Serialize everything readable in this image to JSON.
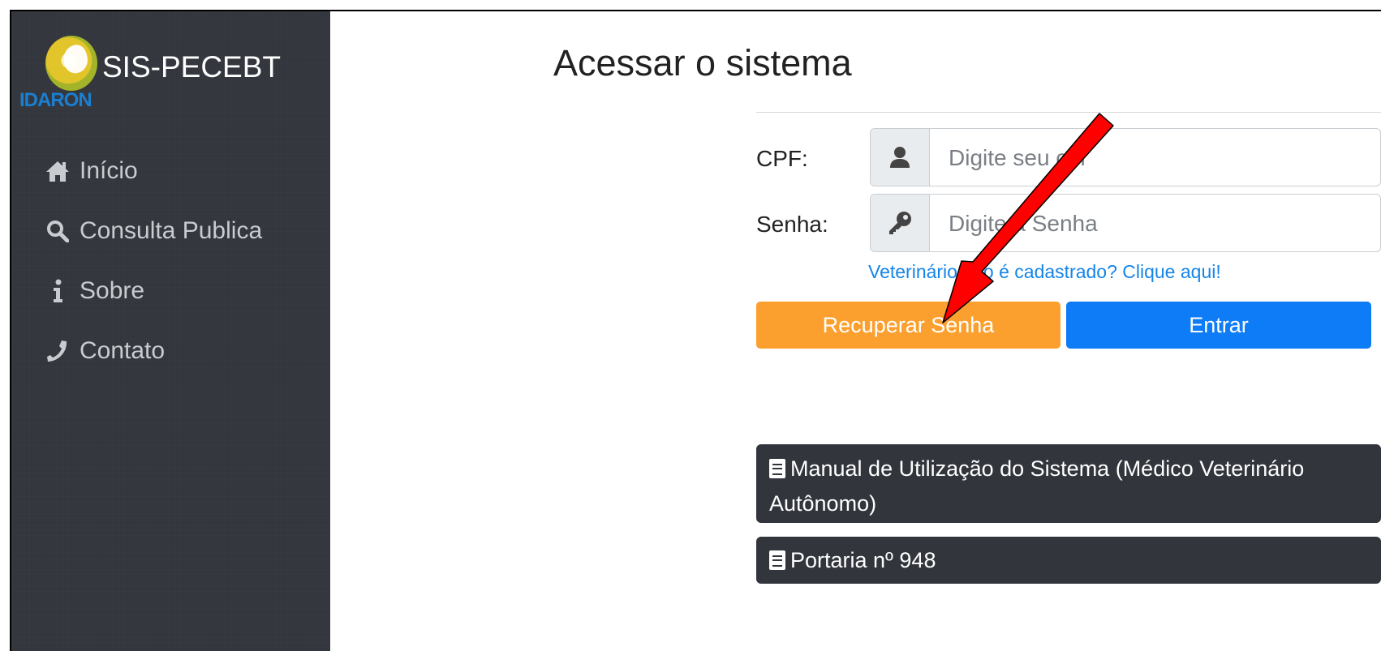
{
  "sidebar": {
    "logo_caption": "IDARON",
    "brand_title": "SIS-PECEBT",
    "items": [
      {
        "label": "Início",
        "icon": "home-icon"
      },
      {
        "label": "Consulta Publica",
        "icon": "search-icon"
      },
      {
        "label": "Sobre",
        "icon": "info-icon"
      },
      {
        "label": "Contato",
        "icon": "phone-icon"
      }
    ]
  },
  "login": {
    "title": "Acessar o sistema",
    "cpf_label": "CPF:",
    "cpf_placeholder": "Digite seu cpf",
    "password_label": "Senha:",
    "password_placeholder": "Digite a Senha",
    "register_link": "Veterinário não é cadastrado? Clique aqui!",
    "recover_button": "Recuperar Senha",
    "enter_button": "Entrar"
  },
  "documents": [
    {
      "label": "Manual de Utilização do Sistema (Médico Veterinário Autônomo)",
      "icon": "book-icon"
    },
    {
      "label": "Portaria nº 948",
      "icon": "book-icon"
    }
  ],
  "colors": {
    "sidebar_bg": "#32363c",
    "recover_button": "#fba02e",
    "enter_button": "#0f7cf7",
    "link": "#1585e8",
    "annotation_arrow": "#ff0000"
  }
}
